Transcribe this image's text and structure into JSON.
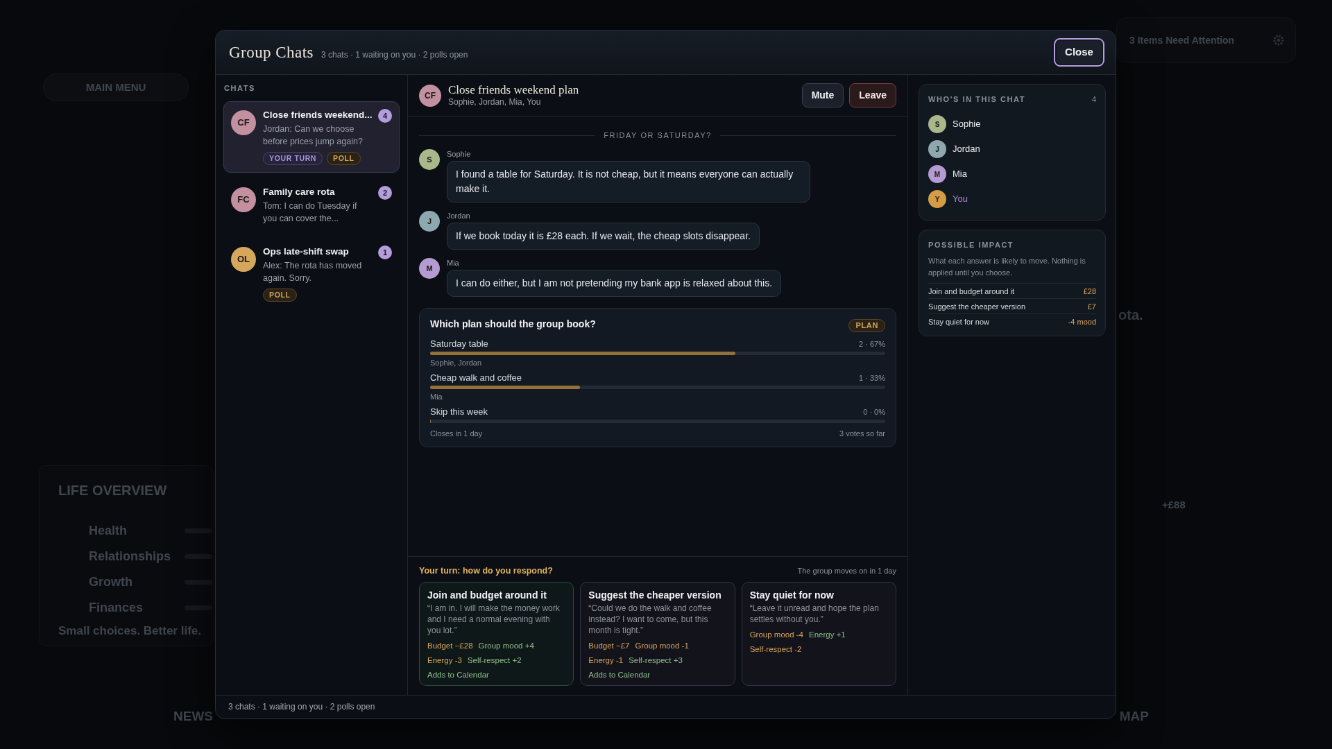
{
  "backdrop": {
    "menu_button": "MAIN MENU",
    "overview": {
      "title": "LIFE OVERVIEW",
      "rows": [
        "Health",
        "Relationships",
        "Growth",
        "Finances"
      ],
      "tagline": "Small choices. Better life."
    },
    "alert": "3 Items Need Attention",
    "fragment": "ota.",
    "amount": "+£88",
    "nav": [
      "NEWS",
      "MAP"
    ]
  },
  "modal": {
    "title": "Group Chats",
    "summary": "3 chats · 1 waiting on you · 2 polls open",
    "close_button": "Close"
  },
  "chat_list": {
    "heading": "CHATS",
    "items": [
      {
        "initials": "CF",
        "color": "#c3909f",
        "title": "Close friends weekend...",
        "preview": "Jordan: Can we choose before prices jump again?",
        "unread": "4",
        "selected": true,
        "tags": [
          {
            "label": "YOUR TURN",
            "kind": "turn"
          },
          {
            "label": "POLL",
            "kind": "poll"
          }
        ]
      },
      {
        "initials": "FC",
        "color": "#c3909f",
        "title": "Family care rota",
        "preview": "Tom: I can do Tuesday if you can cover the...",
        "unread": "2",
        "selected": false
      },
      {
        "initials": "OL",
        "color": "#d4a75c",
        "title": "Ops late-shift swap",
        "preview": "Alex: The rota has moved again. Sorry.",
        "unread": "1",
        "selected": false,
        "tags": [
          {
            "label": "POLL",
            "kind": "poll"
          }
        ]
      }
    ]
  },
  "conversation": {
    "header": {
      "initials": "CF",
      "color": "#c3909f",
      "title": "Close friends weekend plan",
      "members": "Sophie, Jordan, Mia, You",
      "buttons": [
        {
          "label": "Mute",
          "kind": "neutral"
        },
        {
          "label": "Leave",
          "kind": "danger"
        }
      ]
    },
    "divider": "FRIDAY OR SATURDAY?",
    "messages": [
      {
        "author": "Sophie",
        "initial": "S",
        "color": "#a8b88b",
        "text": "I found a table for Saturday. It is not cheap, but it means everyone can actually make it."
      },
      {
        "author": "Jordan",
        "initial": "J",
        "color": "#8ea8af",
        "text": "If we book today it is £28 each. If we wait, the cheap slots disappear."
      },
      {
        "author": "Mia",
        "initial": "M",
        "color": "#b49bd2",
        "text": "I can do either, but I am not pretending my bank app is relaxed about this."
      }
    ],
    "poll": {
      "question": "Which plan should the group book?",
      "tag": "PLAN",
      "options": [
        {
          "label": "Saturday table",
          "result": "2 · 67%",
          "level": 0.67,
          "voters": "Sophie, Jordan"
        },
        {
          "label": "Cheap walk and coffee",
          "result": "1 · 33%",
          "level": 0.33,
          "voters": "Mia"
        },
        {
          "label": "Skip this week",
          "result": "0 · 0%",
          "level": 0
        }
      ],
      "closes": "Closes in 1 day",
      "votes": "3 votes so far"
    }
  },
  "response": {
    "prompt": "Your turn: how do you respond?",
    "deadline": "The group moves on in 1 day",
    "options": [
      {
        "title": "Join and budget around it",
        "quote": "“I am in. I will make the money work and I need a normal evening with you lot.”",
        "selected": true,
        "effect_lines": [
          [
            {
              "text": "Budget −£28",
              "positive": false
            },
            {
              "text": "Group mood +4",
              "positive": true
            }
          ],
          [
            {
              "text": "Energy -3",
              "positive": false
            },
            {
              "text": "Self-respect +2",
              "positive": true
            }
          ]
        ],
        "note": "Adds to Calendar"
      },
      {
        "title": "Suggest the cheaper version",
        "quote": "“Could we do the walk and coffee instead? I want to come, but this month is tight.”",
        "selected": false,
        "effect_lines": [
          [
            {
              "text": "Budget −£7",
              "positive": false
            },
            {
              "text": "Group mood -1",
              "positive": false
            }
          ],
          [
            {
              "text": "Energy -1",
              "positive": false
            },
            {
              "text": "Self-respect +3",
              "positive": true
            }
          ]
        ],
        "note": "Adds to Calendar"
      },
      {
        "title": "Stay quiet for now",
        "quote": "“Leave it unread and hope the plan settles without you.”",
        "selected": false,
        "effect_lines": [
          [
            {
              "text": "Group mood -4",
              "positive": false
            },
            {
              "text": "Energy +1",
              "positive": true
            }
          ],
          [
            {
              "text": "Self-respect -2",
              "positive": false
            }
          ]
        ]
      }
    ]
  },
  "sidebar": {
    "members": {
      "heading": "WHO’S IN THIS CHAT",
      "count": "4",
      "people": [
        {
          "initial": "S",
          "name": "Sophie",
          "color": "#a8b88b",
          "self": false
        },
        {
          "initial": "J",
          "name": "Jordan",
          "color": "#8ea8af",
          "self": false
        },
        {
          "initial": "M",
          "name": "Mia",
          "color": "#b49bd2",
          "self": false
        },
        {
          "initial": "Y",
          "name": "You",
          "color": "#d39c45",
          "self": true
        }
      ]
    },
    "impact": {
      "heading": "POSSIBLE IMPACT",
      "description": "What each answer is likely to move. Nothing is applied until you choose.",
      "rows": [
        {
          "label": "Join and budget around it",
          "value": "£28"
        },
        {
          "label": "Suggest the cheaper version",
          "value": "£7"
        },
        {
          "label": "Stay quiet for now",
          "value": "-4 mood"
        }
      ]
    }
  },
  "status_bar": "3 chats · 1 waiting on you · 2 polls open"
}
